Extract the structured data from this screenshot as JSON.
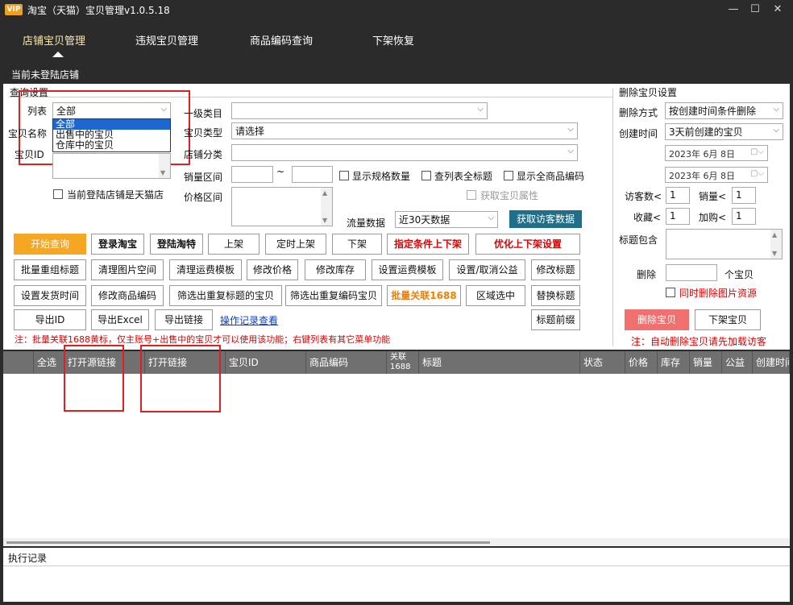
{
  "window": {
    "badge": "VIP",
    "title": "淘宝（天猫）宝贝管理v1.0.5.18",
    "minimize": "—",
    "maximize": "☐",
    "close": "✕"
  },
  "nav": {
    "tabs": [
      "店铺宝贝管理",
      "违规宝贝管理",
      "商品编码查询",
      "下架恢复"
    ],
    "active": 0,
    "login_status": "当前未登陆店铺"
  },
  "query": {
    "group_title": "查询设置",
    "list_label": "列表",
    "list_value": "全部",
    "list_options": [
      "全部",
      "出售中的宝贝",
      "仓库中的宝贝"
    ],
    "name_label": "宝贝名称",
    "id_label": "宝贝ID",
    "tmall_checkbox": "当前登陆店铺是天猫店",
    "cat1_label": "一级类目",
    "cat1_value": "",
    "type_label": "宝贝类型",
    "type_value": "请选择",
    "shopcat_label": "店铺分类",
    "shopcat_value": "",
    "sales_label": "销量区间",
    "sales_sep": "~",
    "price_label": "价格区间",
    "cb_spec": "显示规格数量",
    "cb_fulltitle": "查列表全标题",
    "cb_allcode": "显示全商品编码",
    "cb_attr": "获取宝贝属性",
    "traffic_label": "流量数据",
    "traffic_value": "近30天数据",
    "traffic_btn": "获取访客数据"
  },
  "buttons": {
    "row1": [
      "开始查询",
      "登录淘宝",
      "登陆淘特",
      "上架",
      "定时上架",
      "下架",
      "指定条件上下架",
      "优化上下架设置"
    ],
    "row2": [
      "批量重组标题",
      "清理图片空间",
      "清理运费模板",
      "修改价格",
      "修改库存",
      "设置运费模板",
      "设置/取消公益",
      "修改标题"
    ],
    "row3": [
      "设置发货时间",
      "修改商品编码",
      "筛选出重复标题的宝贝",
      "筛选出重复编码宝贝",
      "批量关联1688",
      "区域选中",
      "替换标题"
    ],
    "row4": [
      "导出ID",
      "导出Excel",
      "导出链接"
    ],
    "log_link": "操作记录查看",
    "title_prefix": "标题前缀"
  },
  "note_left": "注：批量关联1688黄标，仅主账号+出售中的宝贝才可以使用该功能；右键列表有其它菜单功能",
  "delete": {
    "group_title": "删除宝贝设置",
    "method_label": "删除方式",
    "method_value": "按创建时间条件删除",
    "time_label": "创建时间",
    "time_value": "3天前创建的宝贝",
    "date1": "2023年 6月 8日",
    "date2": "2023年 6月 8日",
    "visitors_label": "访客数<",
    "visitors_value": "1",
    "sales_label": "销量<",
    "sales_value": "1",
    "fav_label": "收藏<",
    "fav_value": "1",
    "cart_label": "加购<",
    "cart_value": "1",
    "title_contains_label": "标题包含",
    "del_label": "删除",
    "del_unit": "个宝贝",
    "cb_del_images": "同时删除图片资源",
    "btn_delete": "删除宝贝",
    "btn_offshelf": "下架宝贝",
    "note": "注：自动删除宝贝请先加载访客"
  },
  "table": {
    "columns": [
      "",
      "全选",
      "打开源链接",
      "打开链接",
      "宝贝ID",
      "商品编码",
      "关联1688",
      "标题",
      "状态",
      "价格",
      "库存",
      "销量",
      "公益",
      "创建时间"
    ]
  },
  "log": {
    "title": "执行记录"
  },
  "colors": {
    "dark_bg": "#2b2b2b",
    "accent_orange": "#f5a623",
    "highlight_red": "#e02020",
    "delete_pink": "#f07070",
    "traffic_teal": "#1f6f8b",
    "header_gray": "#707070"
  }
}
